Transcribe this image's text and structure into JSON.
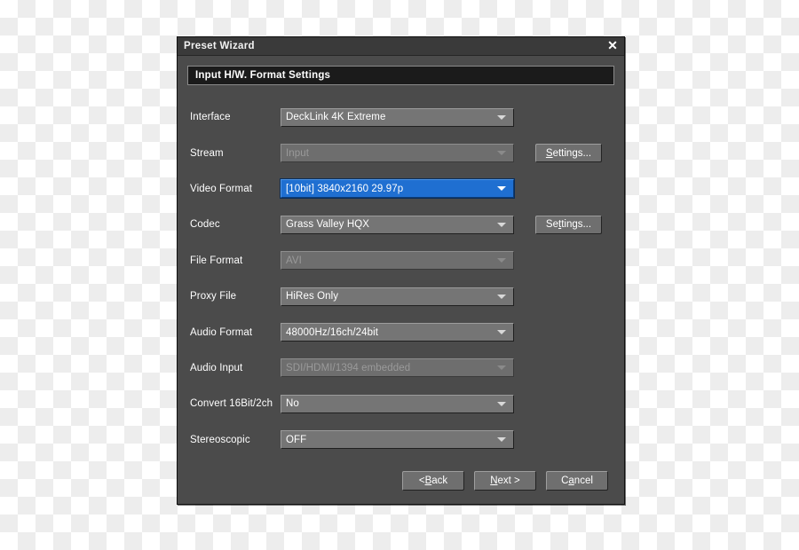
{
  "window": {
    "title": "Preset Wizard",
    "close_icon": "close-icon",
    "close_glyph": "✕"
  },
  "section": {
    "header": "Input H/W. Format Settings"
  },
  "rows": [
    {
      "label": "Interface",
      "value": "DeckLink 4K Extreme",
      "state": "enabled",
      "name": "interface"
    },
    {
      "label": "Stream",
      "value": "Input",
      "state": "disabled",
      "name": "stream",
      "side_button": "Settings..."
    },
    {
      "label": "Video Format",
      "value": "[10bit] 3840x2160 29.97p",
      "state": "selected",
      "name": "video-format"
    },
    {
      "label": "Codec",
      "value": "Grass Valley HQX",
      "state": "enabled",
      "name": "codec",
      "side_button": "Settings..."
    },
    {
      "label": "File Format",
      "value": "AVI",
      "state": "disabled",
      "name": "file-format"
    },
    {
      "label": "Proxy File",
      "value": "HiRes Only",
      "state": "enabled",
      "name": "proxy-file"
    },
    {
      "label": "Audio Format",
      "value": "48000Hz/16ch/24bit",
      "state": "enabled",
      "name": "audio-format"
    },
    {
      "label": "Audio Input",
      "value": "SDI/HDMI/1394 embedded",
      "state": "disabled",
      "name": "audio-input"
    },
    {
      "label": "Convert 16Bit/2ch",
      "value": "No",
      "state": "enabled",
      "name": "convert-16bit-2ch"
    },
    {
      "label": "Stereoscopic",
      "value": "OFF",
      "state": "enabled",
      "name": "stereoscopic"
    }
  ],
  "side_buttons": {
    "stream_settings": {
      "prefix": "S",
      "rest": "ettings..."
    },
    "codec_settings": {
      "prefix": "Se",
      "mnemonic": "t",
      "rest": "tings..."
    }
  },
  "footer": {
    "back": {
      "pre": "< ",
      "mnemonic": "B",
      "post": "ack"
    },
    "next": {
      "pre": "",
      "mnemonic": "N",
      "post": "ext >"
    },
    "cancel": {
      "pre": "C",
      "mnemonic": "a",
      "post": "ncel"
    }
  },
  "colors": {
    "dialog_bg": "#4b4b4b",
    "titlebar_bg": "#3a3a3a",
    "header_bg": "#1b1b1b",
    "combo_bg": "#757575",
    "combo_disabled_bg": "#6e6e6e",
    "selected_blue": "#1f6fd1",
    "text": "#ffffff",
    "text_disabled": "#9a9a9a"
  }
}
